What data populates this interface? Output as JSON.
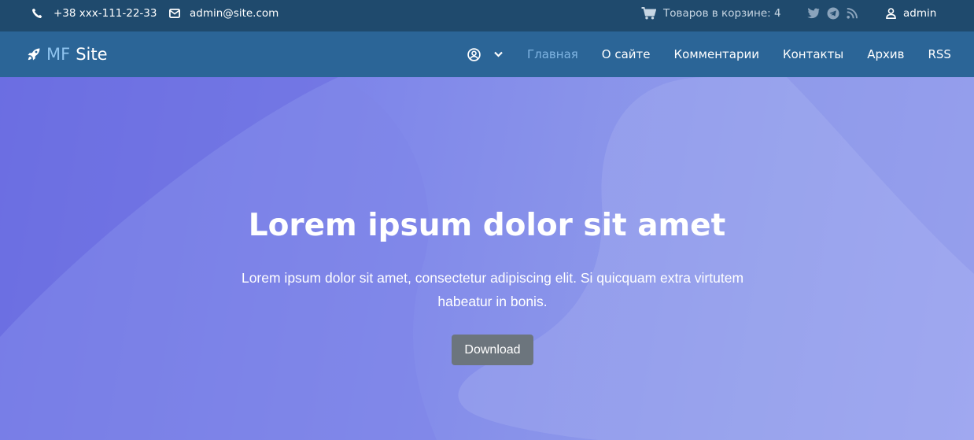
{
  "topbar": {
    "phone": "+38 xxx-111-22-33",
    "email": "admin@site.com",
    "cart": "Товаров в корзине: 4",
    "social_icons": [
      "twitter-icon",
      "telegram-icon",
      "rss-icon"
    ],
    "user": "admin"
  },
  "navbar": {
    "brand_mf": "MF",
    "brand_site": "Site",
    "links": [
      {
        "label": "Главная",
        "active": true
      },
      {
        "label": "О сайте"
      },
      {
        "label": "Комментарии"
      },
      {
        "label": "Контакты"
      },
      {
        "label": "Архив"
      },
      {
        "label": "RSS"
      }
    ]
  },
  "hero": {
    "title": "Lorem ipsum dolor sit amet",
    "subtitle": "Lorem ipsum dolor sit amet, consectetur adipiscing elit. Si quicquam extra virtutem habeatur in bonis.",
    "button": "Download"
  },
  "colors": {
    "topbar_bg": "#1f4a6d",
    "navbar_bg": "#2b6597",
    "active_link": "#7fb4e2",
    "hero_gradient_start": "#6c6fe4",
    "hero_gradient_end": "#9ea6f0",
    "button_bg": "#6c757d"
  }
}
